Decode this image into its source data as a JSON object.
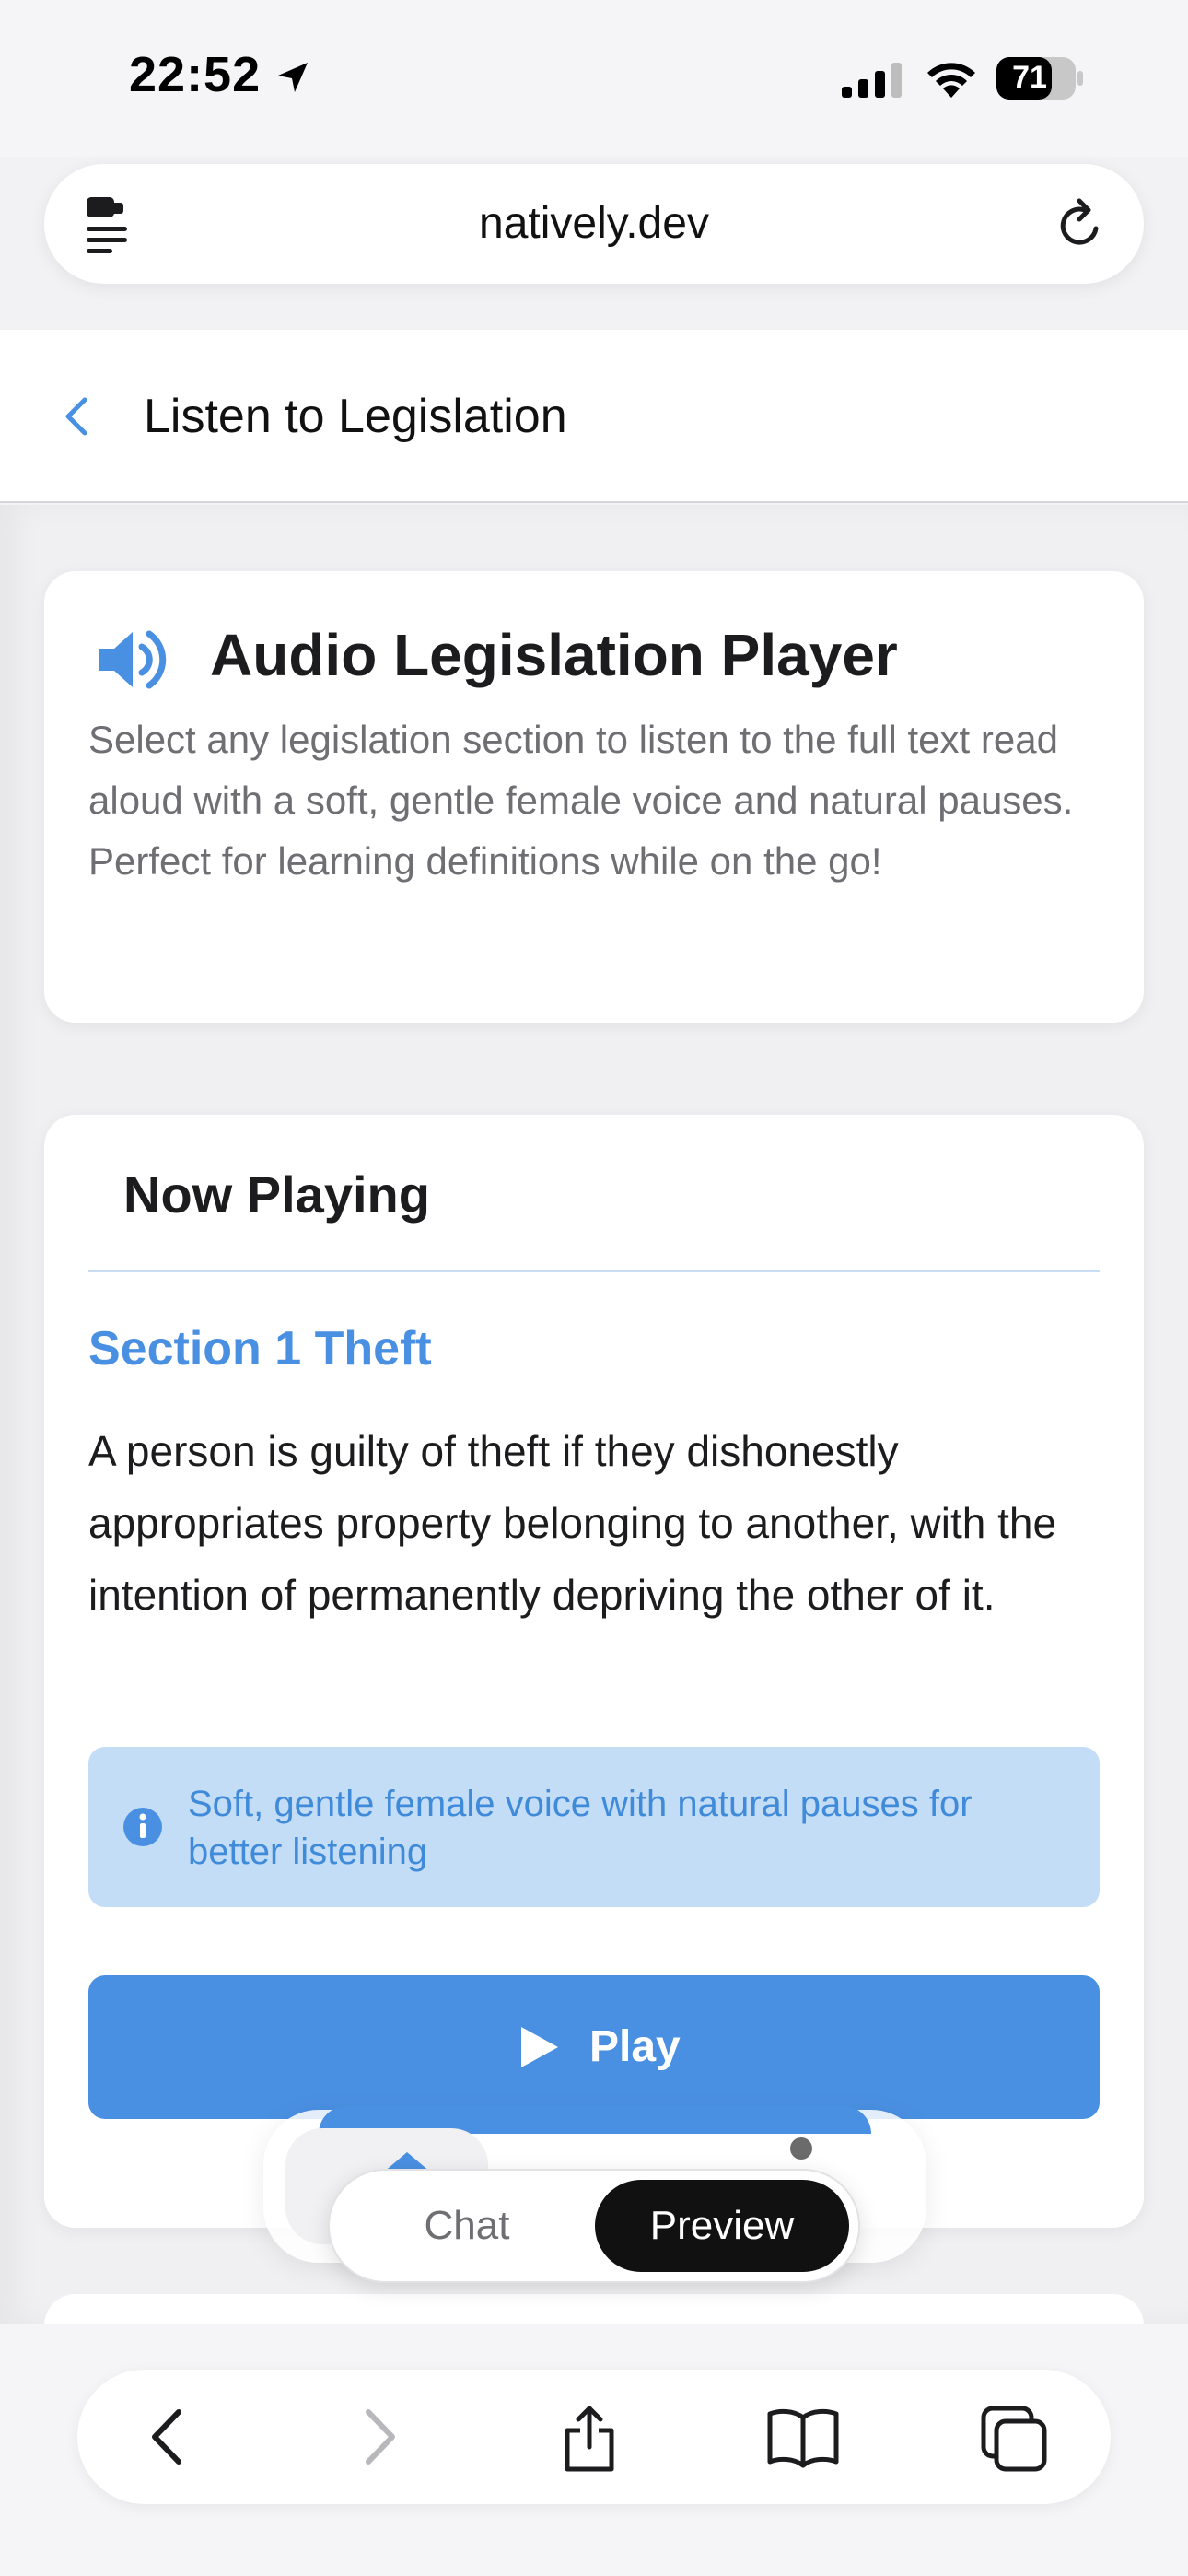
{
  "status_bar": {
    "time": "22:52",
    "battery": "71"
  },
  "browser": {
    "url": "natively.dev"
  },
  "header": {
    "title": "Listen to Legislation"
  },
  "intro_card": {
    "title": "Audio Legislation Player",
    "description": "Select any legislation section to listen to the full text read aloud with a soft, gentle female voice and natural pauses. Perfect for learning definitions while on the go!"
  },
  "player_card": {
    "heading": "Now Playing",
    "section_title": "Section 1 Theft",
    "section_body": "A person is guilty of theft if they dishonestly appropriates property belonging to another, with the intention of permanently depriving the other of it.",
    "voice_note": "Soft, gentle female voice with natural pauses for better listening",
    "play_label": "Play"
  },
  "view_toggle": {
    "chat_label": "Chat",
    "preview_label": "Preview",
    "selected": "Preview"
  },
  "colors": {
    "accent": "#4a90e2",
    "info_bg": "#c4ddf6",
    "text_primary": "#1c1c1e",
    "text_secondary": "#6e6e73"
  },
  "icons": [
    "location-arrow-icon",
    "signal-icon",
    "wifi-icon",
    "battery-icon",
    "site-menu-icon",
    "reload-icon",
    "back-chevron-icon",
    "speaker-icon",
    "info-icon",
    "play-icon",
    "home-icon",
    "user-icon",
    "nav-back-icon",
    "nav-forward-icon",
    "share-icon",
    "bookmarks-icon",
    "tabs-icon"
  ]
}
